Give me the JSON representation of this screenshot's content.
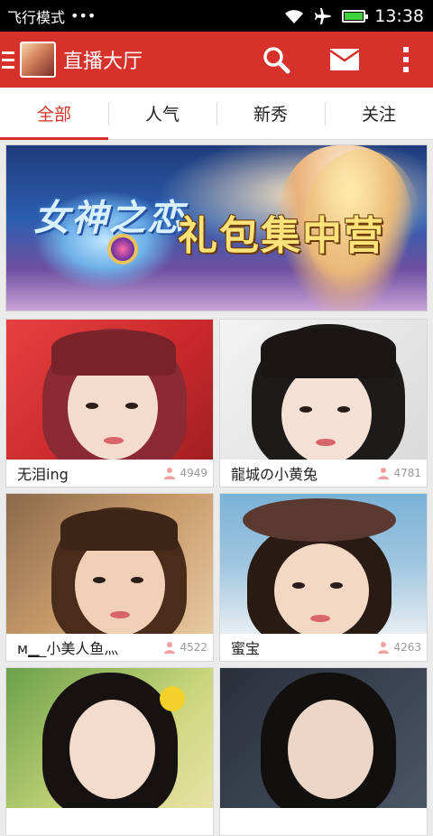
{
  "status_bar": {
    "mode_label": "飞行模式",
    "dots": "•••",
    "time": "13:38",
    "battery_color": "#3cd23c",
    "icons": [
      "wifi-icon",
      "airplane-icon",
      "battery-icon"
    ]
  },
  "app_bar": {
    "title": "直播大厅",
    "color": "#d6322b",
    "icons": [
      "menu-icon",
      "app-avatar",
      "search-icon",
      "mail-icon",
      "more-icon"
    ]
  },
  "tabs": [
    {
      "label": "全部",
      "active": true
    },
    {
      "label": "人气",
      "active": false
    },
    {
      "label": "新秀",
      "active": false
    },
    {
      "label": "关注",
      "active": false
    }
  ],
  "banner": {
    "logo_text": "女神之恋",
    "slogan": "礼包集中营"
  },
  "rooms": [
    {
      "name": "无泪ing",
      "viewers": "4949"
    },
    {
      "name": "龍城の小黄兔",
      "viewers": "4781"
    },
    {
      "name": "м▁_小美人鱼灬",
      "viewers": "4522"
    },
    {
      "name": "蜜宝",
      "viewers": "4263"
    },
    {
      "name": "",
      "viewers": ""
    },
    {
      "name": "",
      "viewers": ""
    }
  ]
}
